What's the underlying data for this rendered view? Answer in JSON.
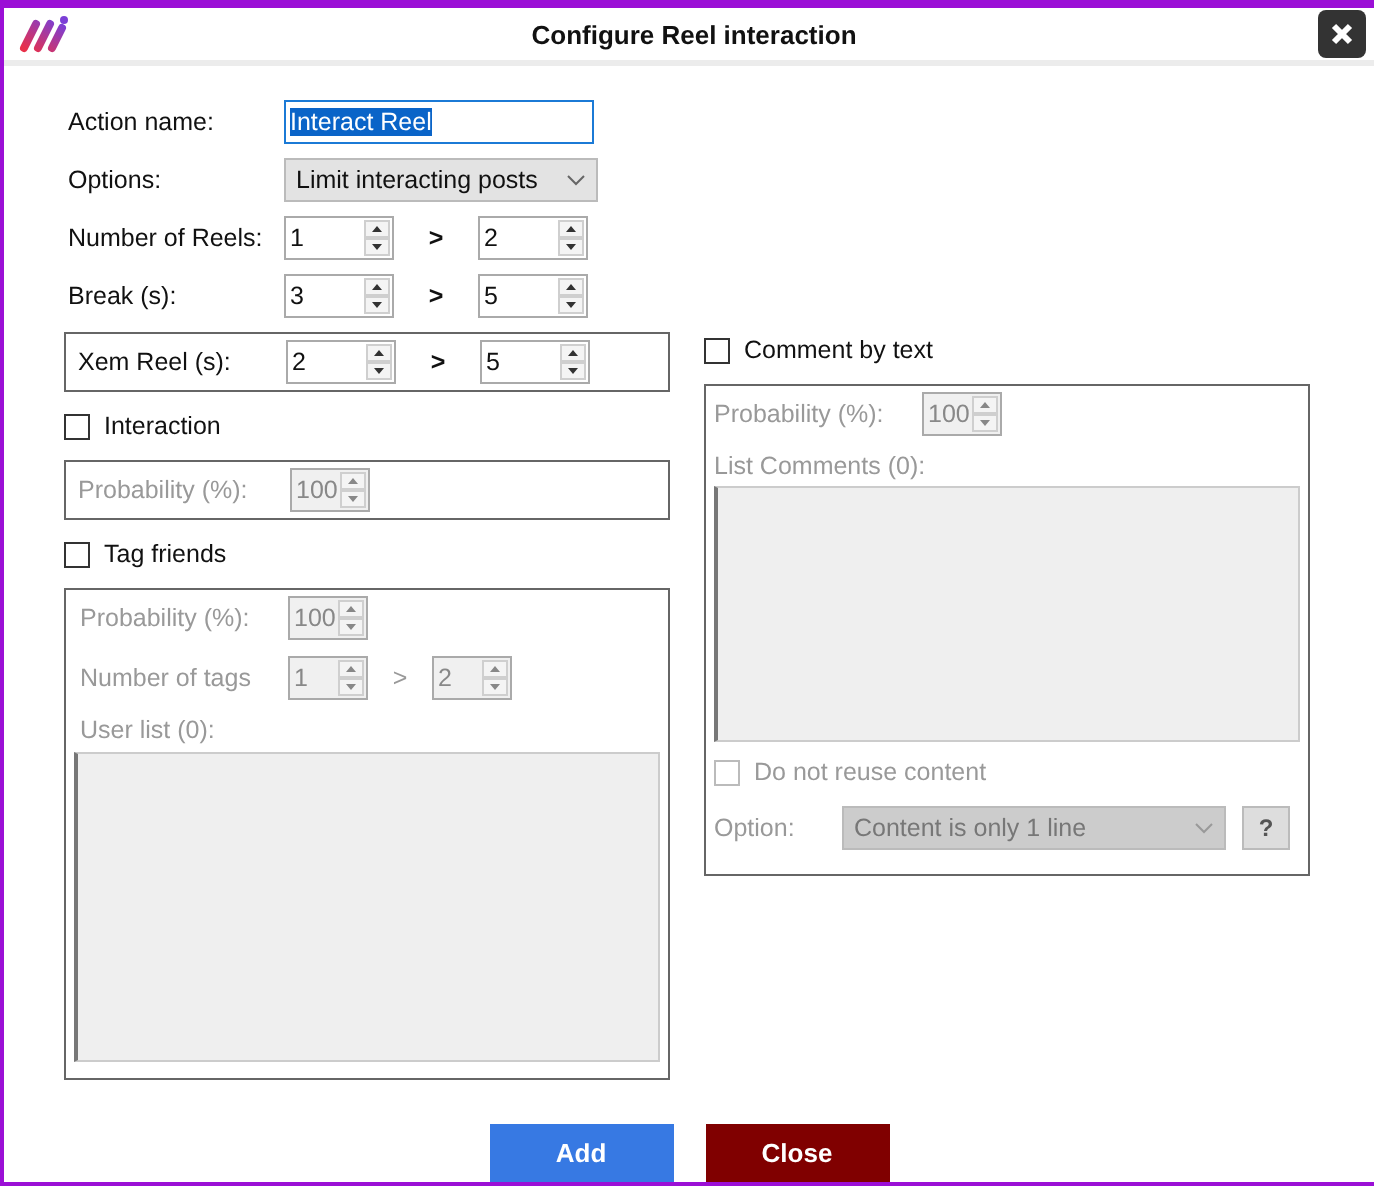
{
  "window": {
    "title": "Configure Reel interaction"
  },
  "action_name": {
    "label": "Action name:",
    "value": "Interact Reel"
  },
  "options": {
    "label": "Options:",
    "value": "Limit interacting posts"
  },
  "ranges": [
    {
      "label": "Number of Reels:",
      "from": "1",
      "separator": ">",
      "to": "2",
      "boxed": false
    },
    {
      "label": "Break (s):",
      "from": "3",
      "separator": ">",
      "to": "5",
      "boxed": false
    },
    {
      "label": "Xem Reel (s):",
      "from": "2",
      "separator": ">",
      "to": "5",
      "boxed": true
    }
  ],
  "interaction": {
    "label": "Interaction",
    "checked": false,
    "probability": {
      "label": "Probability (%):",
      "value": "100"
    }
  },
  "tag_friends": {
    "label": "Tag friends",
    "checked": false,
    "probability": {
      "label": "Probability (%):",
      "value": "100"
    },
    "number_of_tags": {
      "label": "Number of tags",
      "from": "1",
      "separator": ">",
      "to": "2"
    },
    "user_list_label": "User list (0):"
  },
  "comment_by_text": {
    "label": "Comment by text",
    "checked": false,
    "probability": {
      "label": "Probability (%):",
      "value": "100"
    },
    "list_label": "List Comments (0):",
    "do_not_reuse": {
      "label": "Do not reuse content",
      "checked": false
    },
    "option": {
      "label": "Option:",
      "value": "Content is only 1 line"
    },
    "help": "?"
  },
  "buttons": [
    {
      "label": "Add",
      "kind": "primary"
    },
    {
      "label": "Close",
      "kind": "danger"
    }
  ]
}
